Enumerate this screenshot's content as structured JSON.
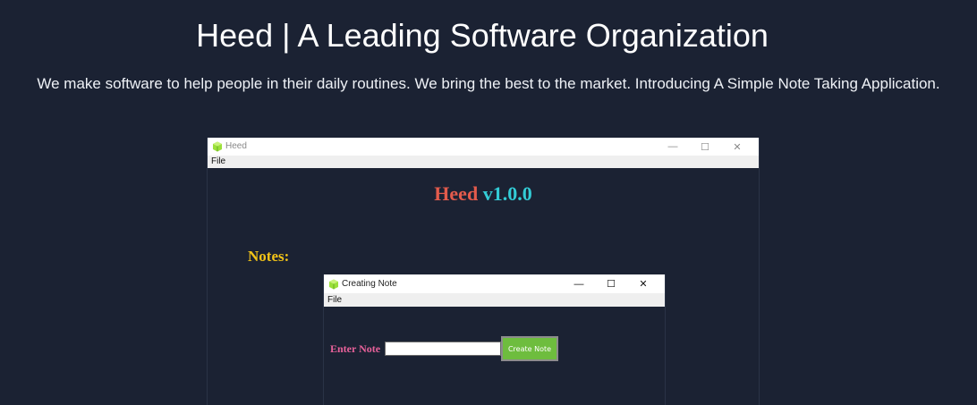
{
  "page": {
    "title": "Heed | A Leading Software Organization",
    "tagline": "We make software to help people in their daily routines. We bring the best to the market. Introducing A Simple Note Taking Application."
  },
  "main_window": {
    "title": "Heed",
    "menu": [
      "File"
    ],
    "app_name": "Heed",
    "version": "v1.0.0",
    "notes_label": "Notes:",
    "controls": {
      "minimize": "—",
      "maximize": "☐",
      "close": "✕"
    }
  },
  "note_window": {
    "title": "Creating Note",
    "menu": [
      "File"
    ],
    "enter_label": "Enter Note",
    "input_value": "",
    "button_label": "Create Note",
    "controls": {
      "minimize": "—",
      "maximize": "☐",
      "close": "✕"
    }
  },
  "colors": {
    "background": "#1b2233",
    "app_name": "#e35b4c",
    "version": "#33ccd6",
    "notes_label": "#f2c318",
    "enter_label": "#e8619a",
    "button": "#6ebd3e",
    "app_icon": "#9be03a"
  },
  "icons": {
    "app_icon": "cube-icon"
  }
}
